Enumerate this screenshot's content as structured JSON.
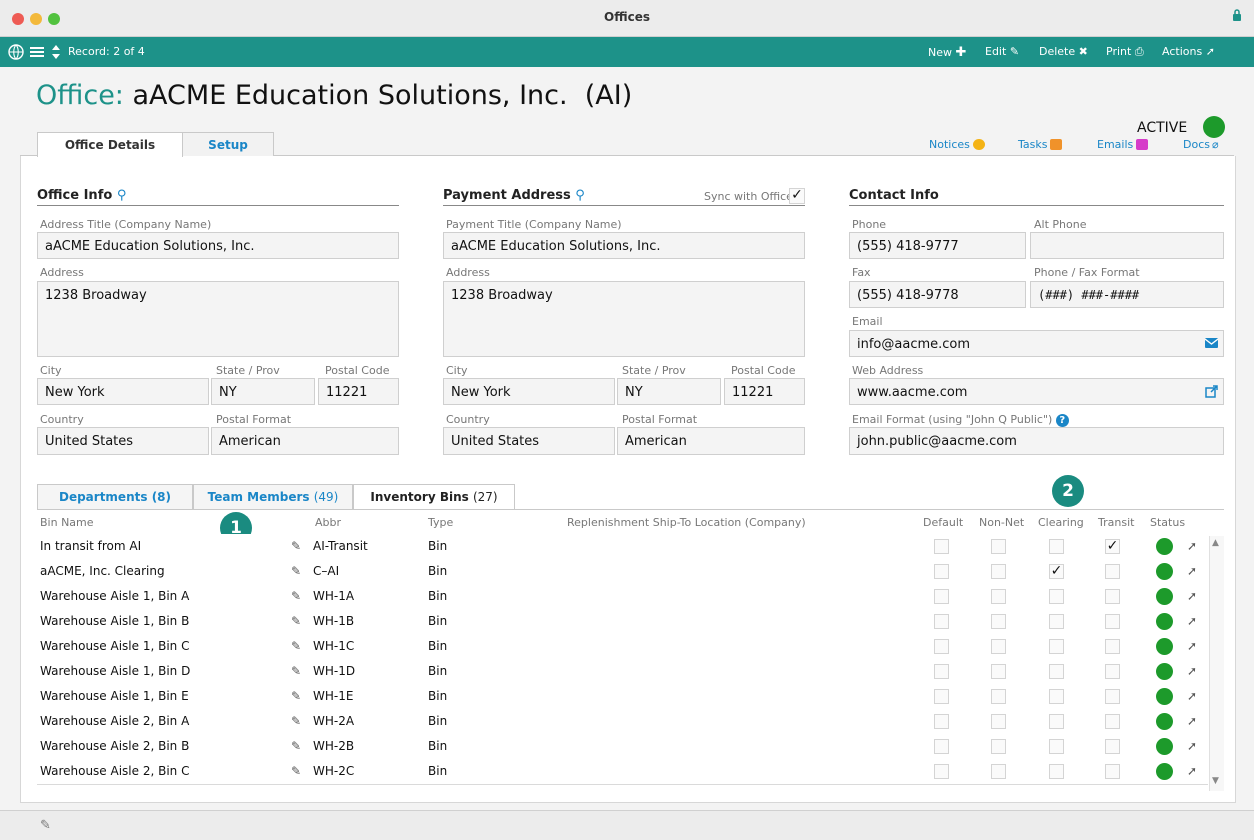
{
  "window": {
    "title": "Offices"
  },
  "toolbar": {
    "record": "Record: 2 of 4",
    "new_label": "New",
    "edit_label": "Edit",
    "delete_label": "Delete",
    "print_label": "Print",
    "actions_label": "Actions",
    "color": "#1d9289"
  },
  "header": {
    "title_prefix": "Office:",
    "title_name": "aACME Education Solutions, Inc.  (AI)",
    "status_label": "ACTIVE",
    "status_color": "#1d9a2b"
  },
  "tabs": {
    "office_details": "Office Details",
    "setup": "Setup"
  },
  "links": {
    "notices": "Notices",
    "tasks": "Tasks",
    "emails": "Emails",
    "docs": "Docs"
  },
  "office_info": {
    "title": "Office Info",
    "address_title_label": "Address Title (Company Name)",
    "address_title": "aACME Education Solutions, Inc.",
    "address_label": "Address",
    "address": "1238 Broadway",
    "city_label": "City",
    "city": "New York",
    "state_label": "State / Prov",
    "state": "NY",
    "postal_label": "Postal Code",
    "postal": "11221",
    "country_label": "Country",
    "country": "United States",
    "postal_format_label": "Postal Format",
    "postal_format": "American"
  },
  "payment_address": {
    "title": "Payment Address",
    "sync_label": "Sync with Office",
    "sync_checked": "✓",
    "payment_title_label": "Payment Title (Company Name)",
    "payment_title": "aACME Education Solutions, Inc.",
    "address_label": "Address",
    "address": "1238 Broadway",
    "city_label": "City",
    "city": "New York",
    "state_label": "State / Prov",
    "state": "NY",
    "postal_label": "Postal Code",
    "postal": "11221",
    "country_label": "Country",
    "country": "United States",
    "postal_format_label": "Postal Format",
    "postal_format": "American"
  },
  "contact_info": {
    "title": "Contact Info",
    "phone_label": "Phone",
    "phone": "(555) 418-9777",
    "alt_phone_label": "Alt Phone",
    "alt_phone": "",
    "fax_label": "Fax",
    "fax": "(555) 418-9778",
    "format_label": "Phone / Fax Format",
    "format": "(###) ###-####",
    "email_label": "Email",
    "email": "info@aacme.com",
    "web_label": "Web Address",
    "web": "www.aacme.com",
    "email_format_label": "Email Format (using \"John Q Public\")",
    "email_format": "john.public@aacme.com"
  },
  "bottom_tabs": {
    "departments": "Departments",
    "departments_count": "(8)",
    "team_members": "Team Members",
    "team_members_count": "(49)",
    "inventory_bins": "Inventory Bins",
    "inventory_bins_count": "(27)"
  },
  "badges": {
    "one": "1",
    "two": "2"
  },
  "columns": {
    "bin_name": "Bin Name",
    "abbr": "Abbr",
    "type": "Type",
    "replenishment": "Replenishment Ship-To Location (Company)",
    "default": "Default",
    "non_net": "Non-Net",
    "clearing": "Clearing",
    "transit": "Transit",
    "status": "Status"
  },
  "bins": [
    {
      "name": "In transit from AI",
      "abbr": "AI-Transit",
      "type": "Bin",
      "clearing": "",
      "transit": "✓"
    },
    {
      "name": "aACME, Inc. Clearing",
      "abbr": "C–AI",
      "type": "Bin",
      "clearing": "✓",
      "transit": ""
    },
    {
      "name": "Warehouse Aisle 1, Bin A",
      "abbr": "WH-1A",
      "type": "Bin",
      "clearing": "",
      "transit": ""
    },
    {
      "name": "Warehouse Aisle 1, Bin B",
      "abbr": "WH-1B",
      "type": "Bin",
      "clearing": "",
      "transit": ""
    },
    {
      "name": "Warehouse Aisle 1, Bin C",
      "abbr": "WH-1C",
      "type": "Bin",
      "clearing": "",
      "transit": ""
    },
    {
      "name": "Warehouse Aisle 1, Bin D",
      "abbr": "WH-1D",
      "type": "Bin",
      "clearing": "",
      "transit": ""
    },
    {
      "name": "Warehouse Aisle 1, Bin E",
      "abbr": "WH-1E",
      "type": "Bin",
      "clearing": "",
      "transit": ""
    },
    {
      "name": "Warehouse Aisle 2, Bin A",
      "abbr": "WH-2A",
      "type": "Bin",
      "clearing": "",
      "transit": ""
    },
    {
      "name": "Warehouse Aisle 2, Bin B",
      "abbr": "WH-2B",
      "type": "Bin",
      "clearing": "",
      "transit": ""
    },
    {
      "name": "Warehouse Aisle 2, Bin C",
      "abbr": "WH-2C",
      "type": "Bin",
      "clearing": "",
      "transit": ""
    }
  ]
}
